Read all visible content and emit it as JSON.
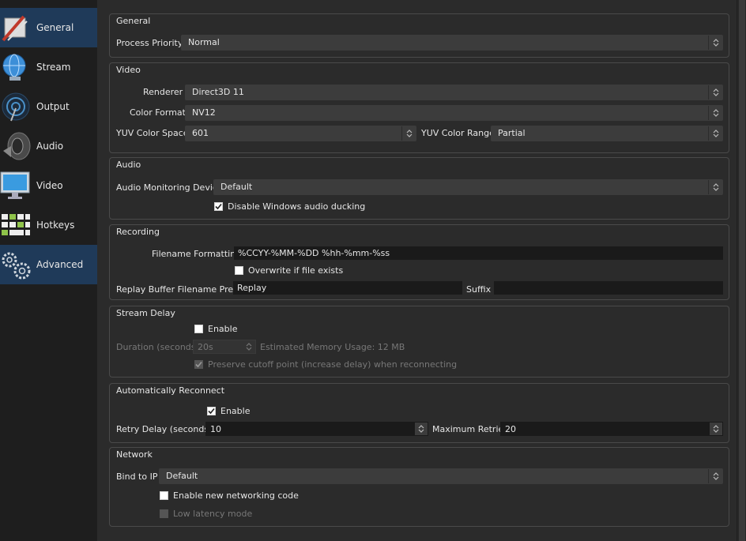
{
  "sidebar": {
    "items": [
      {
        "label": "General",
        "icon": "general-settings-icon",
        "active": true
      },
      {
        "label": "Stream",
        "icon": "stream-globe-icon",
        "active": false
      },
      {
        "label": "Output",
        "icon": "output-broadcast-icon",
        "active": false
      },
      {
        "label": "Audio",
        "icon": "audio-speaker-icon",
        "active": false
      },
      {
        "label": "Video",
        "icon": "video-monitor-icon",
        "active": false
      },
      {
        "label": "Hotkeys",
        "icon": "hotkeys-keyboard-icon",
        "active": false
      },
      {
        "label": "Advanced",
        "icon": "advanced-gears-icon",
        "active": true
      }
    ]
  },
  "general": {
    "title": "General",
    "process_priority_label": "Process Priority",
    "process_priority_value": "Normal"
  },
  "video": {
    "title": "Video",
    "renderer_label": "Renderer",
    "renderer_value": "Direct3D 11",
    "color_format_label": "Color Format",
    "color_format_value": "NV12",
    "yuv_space_label": "YUV Color Space",
    "yuv_space_value": "601",
    "yuv_range_label": "YUV Color Range",
    "yuv_range_value": "Partial"
  },
  "audio": {
    "title": "Audio",
    "monitoring_label": "Audio Monitoring Device",
    "monitoring_value": "Default",
    "ducking_label": "Disable Windows audio ducking",
    "ducking_checked": true
  },
  "recording": {
    "title": "Recording",
    "filename_label": "Filename Formatting",
    "filename_value": "%CCYY-%MM-%DD %hh-%mm-%ss",
    "overwrite_label": "Overwrite if file exists",
    "overwrite_checked": false,
    "replay_prefix_label": "Replay Buffer Filename Prefix",
    "replay_prefix_value": "Replay",
    "suffix_label": "Suffix",
    "suffix_value": ""
  },
  "stream_delay": {
    "title": "Stream Delay",
    "enable_label": "Enable",
    "enable_checked": false,
    "duration_label": "Duration (seconds)",
    "duration_value": "20s",
    "memory_usage": "Estimated Memory Usage: 12 MB",
    "preserve_label": "Preserve cutoff point (increase delay) when reconnecting",
    "preserve_checked": true
  },
  "reconnect": {
    "title": "Automatically Reconnect",
    "enable_label": "Enable",
    "enable_checked": true,
    "retry_delay_label": "Retry Delay (seconds)",
    "retry_delay_value": "10",
    "max_retries_label": "Maximum Retries",
    "max_retries_value": "20"
  },
  "network": {
    "title": "Network",
    "bind_ip_label": "Bind to IP",
    "bind_ip_value": "Default",
    "new_networking_label": "Enable new networking code",
    "new_networking_checked": false,
    "low_latency_label": "Low latency mode",
    "low_latency_checked": false
  },
  "colors": {
    "sidebar_bg": "#1e1e1e",
    "active_item_bg": "#1f3a59",
    "panel_bg": "#2b2b2b",
    "group_border": "#4a4a4a",
    "field_bg": "#1a1a1a",
    "combo_bg": "#3c3c3c"
  }
}
